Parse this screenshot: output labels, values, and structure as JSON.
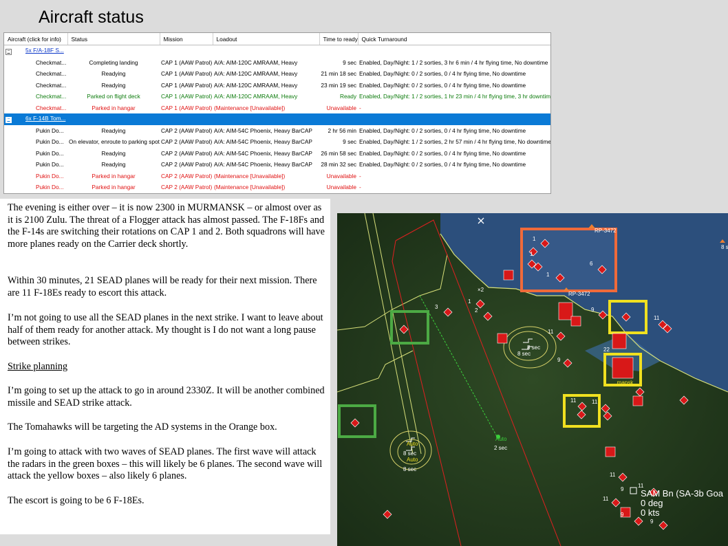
{
  "title": "Aircraft status",
  "grid": {
    "columns": [
      "Aircraft (click for info)",
      "Status",
      "Mission",
      "Loadout",
      "Time to ready",
      "Quick Turnaround"
    ],
    "rows": [
      {
        "type": "group",
        "expander": "−",
        "name": "5x F/A-18F S..."
      },
      {
        "type": "normal",
        "name": "Checkmat...",
        "status": "Completing landing",
        "mission": "CAP 1 (AAW Patrol)",
        "loadout": "A/A: AIM-120C AMRAAM, Heavy",
        "ready": "9 sec",
        "qt": "Enabled, Day/Night: 1 / 2 sorties, 3 hr 6 min / 4 hr flying time, No downtime"
      },
      {
        "type": "normal",
        "name": "Checkmat...",
        "status": "Readying",
        "mission": "CAP 1 (AAW Patrol)",
        "loadout": "A/A: AIM-120C AMRAAM, Heavy",
        "ready": "21 min 18 sec",
        "qt": "Enabled, Day/Night: 0 / 2 sorties, 0 / 4 hr flying time, No downtime"
      },
      {
        "type": "normal",
        "name": "Checkmat...",
        "status": "Readying",
        "mission": "CAP 1 (AAW Patrol)",
        "loadout": "A/A: AIM-120C AMRAAM, Heavy",
        "ready": "23 min 19 sec",
        "qt": "Enabled, Day/Night: 0 / 2 sorties, 0 / 4 hr flying time, No downtime"
      },
      {
        "type": "green",
        "name": "Checkmat...",
        "status": "Parked on flight deck",
        "mission": "CAP 1 (AAW Patrol)",
        "loadout": "A/A: AIM-120C AMRAAM, Heavy",
        "ready": "Ready",
        "qt": "Enabled, Day/Night: 1 / 2 sorties, 1 hr 23 min / 4 hr flying time, 3 hr downtime"
      },
      {
        "type": "red",
        "name": "Checkmat...",
        "status": "Parked in hangar",
        "mission": "CAP 1 (AAW Patrol)",
        "loadout": "(Maintenance [Unavailable])",
        "ready": "Unavailable",
        "qt": "-"
      },
      {
        "type": "group selected",
        "expander": "−",
        "name": "6x F-14B Tom..."
      },
      {
        "type": "normal",
        "name": "Pukin Do...",
        "status": "Readying",
        "mission": "CAP 2 (AAW Patrol)",
        "loadout": "A/A: AIM-54C Phoenix, Heavy BarCAP",
        "ready": "2 hr 56 min",
        "qt": "Enabled, Day/Night: 0 / 2 sorties, 0 / 4 hr flying time, No downtime"
      },
      {
        "type": "normal",
        "name": "Pukin Do...",
        "status": "On elevator, enroute to parking spot",
        "mission": "CAP 2 (AAW Patrol)",
        "loadout": "A/A: AIM-54C Phoenix, Heavy BarCAP",
        "ready": "9 sec",
        "qt": "Enabled, Day/Night: 1 / 2 sorties, 2 hr 57 min / 4 hr flying time, No downtime"
      },
      {
        "type": "normal",
        "name": "Pukin Do...",
        "status": "Readying",
        "mission": "CAP 2 (AAW Patrol)",
        "loadout": "A/A: AIM-54C Phoenix, Heavy BarCAP",
        "ready": "26 min 58 sec",
        "qt": "Enabled, Day/Night: 0 / 2 sorties, 0 / 4 hr flying time, No downtime"
      },
      {
        "type": "normal",
        "name": "Pukin Do...",
        "status": "Readying",
        "mission": "CAP 2 (AAW Patrol)",
        "loadout": "A/A: AIM-54C Phoenix, Heavy BarCAP",
        "ready": "28 min 32 sec",
        "qt": "Enabled, Day/Night: 0 / 2 sorties, 0 / 4 hr flying time, No downtime"
      },
      {
        "type": "red",
        "name": "Pukin Do...",
        "status": "Parked in hangar",
        "mission": "CAP 2 (AAW Patrol)",
        "loadout": "(Maintenance [Unavailable])",
        "ready": "Unavailable",
        "qt": "-"
      },
      {
        "type": "red",
        "name": "Pukin Do...",
        "status": "Parked in hangar",
        "mission": "CAP 2 (AAW Patrol)",
        "loadout": "(Maintenance [Unavailable])",
        "ready": "Unavailable",
        "qt": "-"
      }
    ]
  },
  "narrative": {
    "p1": "The evening is either over – it is now 2300 in MURMANSK – or almost over as it is 2100 Zulu.  The threat of a Flogger attack has almost passed.  The F-18Fs and the F-14s are switching their rotations on CAP 1 and 2.  Both squadrons will have more planes ready on the Carrier deck shortly.",
    "p2": "Within 30 minutes, 21 SEAD planes will be ready for their next mission. There are 11 F-18Es ready to escort this attack.",
    "p3": "I’m not going to use all the SEAD planes in the next strike.  I want to leave about half of them ready for another attack.  My thought is I do not want a long pause between strikes.",
    "heading": "Strike planning",
    "p4": "I’m going to set up the attack to go in around 2330Z.  It will be another combined missile and SEAD strike attack.",
    "p5": "The Tomahawks will be targeting the AD systems in the Orange box.",
    "p6": "I’m going to attack with two waves of SEAD planes.  The first wave will attack the radars in the green boxes – this will likely be 6 planes.  The second wave will attack the yellow boxes – also likely 6 planes.",
    "p7": "The escort is going to be 6 F-18Es."
  },
  "map": {
    "labels": {
      "rp1": "RP-3472",
      "rp2": "RP-3472",
      "rp3": "8 s",
      "x2": "×2",
      "murmansk": "...mansk",
      "auto1": "Auto",
      "auto1sec": "8 sec",
      "auto2": "Auto",
      "auto2sec": "8 sec",
      "auto3": "Auto",
      "auto3sec": "2 sec",
      "sec1": "8 sec",
      "sec2": "8 sec",
      "sam_name": "SAM Bn (SA-3b Goa",
      "sam_heading": "0 deg",
      "sam_speed": "0 kts",
      "n1": "1",
      "n2": "1",
      "n3": "6",
      "n4": "1",
      "n5": "3",
      "n6": "1",
      "n7": "2",
      "n8": "9",
      "n9": "11",
      "n10": "11",
      "n11": "22",
      "n12": "9",
      "n13": "11",
      "n14": "11",
      "n15": "11",
      "n16": "9",
      "n17": "11",
      "n18": "11",
      "n19": "9",
      "n20": "9"
    },
    "colors": {
      "orange_box": "#f06a3a",
      "yellow_box": "#f0e020",
      "green_box": "#4caa44",
      "unit_red": "#d81818",
      "coast": "#d8e07a",
      "sea": "#2c4f7c",
      "land": "#243a1e"
    }
  }
}
